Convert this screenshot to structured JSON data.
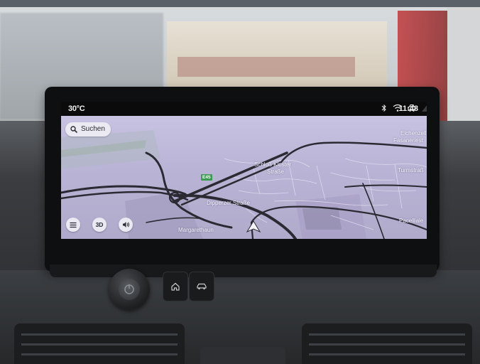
{
  "status_bar": {
    "temperature": "30°C",
    "time": "11:48",
    "icons": [
      "bluetooth-icon",
      "wifi-icon",
      "connected-car-icon",
      "signal-icon"
    ]
  },
  "search": {
    "label": "Suchen",
    "icon": "search-icon"
  },
  "map": {
    "highway_shield": "E45",
    "labels": {
      "eichenzell": "Eichenzell",
      "fasanerie": "Fasaneriest",
      "kloster": "Schloß Kloster",
      "strasse": "Straße",
      "turmstr": "Turmstraß",
      "dipperz": "Dipperzer Straße",
      "margaret": "Margarethaun",
      "pacelli": "Pacelliale"
    },
    "colors": {
      "map_bg": "#c0bade",
      "roads": "#2b2a33",
      "highway": "#3c9a52"
    }
  },
  "controls": {
    "menu_icon": "menu-icon",
    "view_label": "3D",
    "sound_icon": "speaker-icon"
  },
  "hardware": {
    "home_icon": "home-icon",
    "car_icon": "car-icon"
  }
}
